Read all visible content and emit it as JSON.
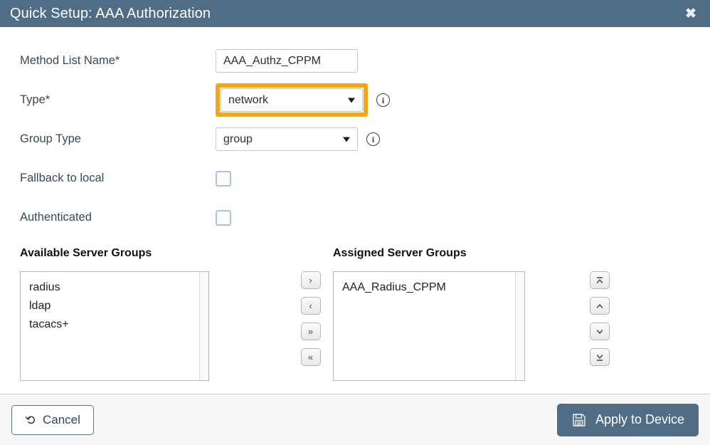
{
  "header": {
    "title": "Quick Setup: AAA Authorization",
    "close_label": "✖",
    "bg_color": "#4f6d85"
  },
  "form": {
    "method_list_name": {
      "label": "Method List Name*",
      "value": "AAA_Authz_CPPM",
      "placeholder": ""
    },
    "type": {
      "label": "Type*",
      "value": "network",
      "info_label": "i",
      "highlight_color": "#f0a818"
    },
    "group_type": {
      "label": "Group Type",
      "value": "group",
      "info_label": "i"
    },
    "fallback_to_local": {
      "label": "Fallback to local",
      "checked": false
    },
    "authenticated": {
      "label": "Authenticated",
      "checked": false
    }
  },
  "transfer": {
    "available_heading": "Available Server Groups",
    "assigned_heading": "Assigned Server Groups",
    "available_items": [
      "radius",
      "ldap",
      "tacacs+"
    ],
    "assigned_items": [
      "AAA_Radius_CPPM"
    ],
    "move_buttons": [
      {
        "name": "move-right",
        "glyph": "›"
      },
      {
        "name": "move-left",
        "glyph": "‹"
      },
      {
        "name": "move-all-right",
        "glyph": "»"
      },
      {
        "name": "move-all-left",
        "glyph": "«"
      }
    ],
    "order_buttons": [
      {
        "name": "move-to-top",
        "glyph": "top"
      },
      {
        "name": "move-up",
        "glyph": "up"
      },
      {
        "name": "move-down",
        "glyph": "down"
      },
      {
        "name": "move-to-bottom",
        "glyph": "bottom"
      }
    ]
  },
  "footer": {
    "cancel_label": "Cancel",
    "apply_label": "Apply to Device",
    "apply_bg_color": "#4f6d85"
  }
}
